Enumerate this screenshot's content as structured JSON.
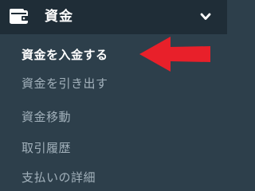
{
  "header": {
    "title": "資金",
    "icon": "wallet-icon",
    "toggle_icon": "chevron-down-icon"
  },
  "menu": {
    "items": [
      {
        "label": "資金を入金する",
        "active": true
      },
      {
        "label": "資金を引き出す",
        "active": false
      },
      {
        "label": "資金移動",
        "active": false
      },
      {
        "label": "取引履歴",
        "active": false
      },
      {
        "label": "支払いの詳細",
        "active": false
      }
    ]
  },
  "annotation": {
    "icon": "red-arrow-icon",
    "color": "#e8202a"
  },
  "colors": {
    "header_bg": "#1f2d37",
    "panel_bg": "#2d3f4b",
    "active_text": "#ffffff",
    "inactive_text": "#a2b1bb"
  }
}
